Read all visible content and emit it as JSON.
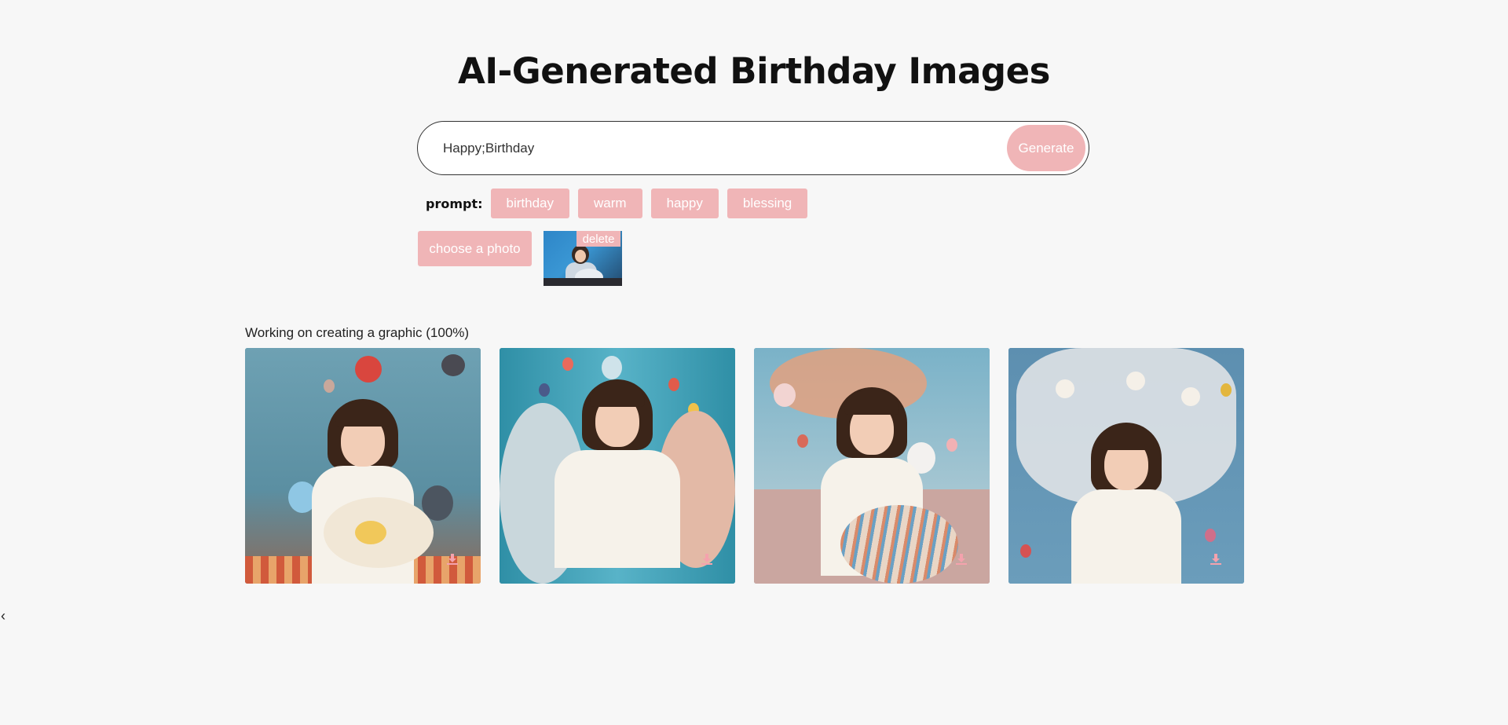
{
  "header": {
    "title": "AI-Generated Birthday Images"
  },
  "search": {
    "value": "Happy;Birthday",
    "generate_label": "Generate"
  },
  "prompts": {
    "label": "prompt:",
    "tags": [
      "birthday",
      "warm",
      "happy",
      "blessing"
    ]
  },
  "upload": {
    "choose_label": "choose a photo",
    "delete_label": "delete"
  },
  "results": {
    "status": "Working on creating a graphic (100%)",
    "images": [
      {
        "icon": "download-icon"
      },
      {
        "icon": "download-icon"
      },
      {
        "icon": "download-icon"
      },
      {
        "icon": "download-icon"
      }
    ]
  },
  "nav": {
    "back_glyph": "‹"
  },
  "colors": {
    "accent": "#f0b5b7",
    "background": "#f7f7f7"
  }
}
